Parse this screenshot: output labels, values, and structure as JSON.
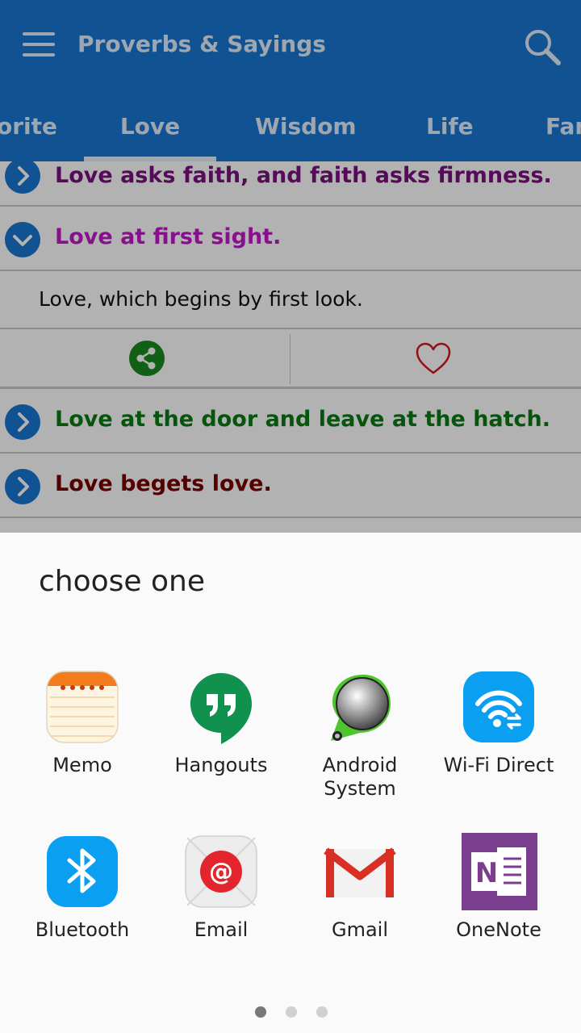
{
  "appbar": {
    "title": "Proverbs & Sayings"
  },
  "tabs": [
    {
      "label": "Favorite",
      "display": "orite"
    },
    {
      "label": "Love",
      "selected": true
    },
    {
      "label": "Wisdom"
    },
    {
      "label": "Life"
    },
    {
      "label": "Family",
      "display": "Far"
    }
  ],
  "proverbs": [
    {
      "text": "Love asks faith, and faith asks firmness.",
      "color": "#7b1080",
      "expanded": false
    },
    {
      "text": "Love at first sight.",
      "color": "#c218c9",
      "expanded": true,
      "meaning": "Love, which begins by first look."
    },
    {
      "text": "Love at the door and leave at the hatch.",
      "color": "#0a7a14",
      "expanded": false
    },
    {
      "text": "Love begets love.",
      "color": "#7a0000",
      "expanded": false
    }
  ],
  "actions": {
    "share_icon": "share-icon",
    "favorite_icon": "heart-outline-icon"
  },
  "share_sheet": {
    "title": "choose one",
    "apps": [
      {
        "label": "Memo",
        "icon": "memo-icon"
      },
      {
        "label": "Hangouts",
        "icon": "hangouts-icon"
      },
      {
        "label": "Android System",
        "line1": "Android",
        "line2": "System",
        "icon": "android-system-icon"
      },
      {
        "label": "Wi-Fi Direct",
        "icon": "wifi-direct-icon"
      },
      {
        "label": "Bluetooth",
        "icon": "bluetooth-icon"
      },
      {
        "label": "Email",
        "icon": "email-icon"
      },
      {
        "label": "Gmail",
        "icon": "gmail-icon"
      },
      {
        "label": "OneNote",
        "icon": "onenote-icon"
      }
    ],
    "pages": 3,
    "current_page": 1
  },
  "colors": {
    "primary": "#1976d2",
    "appbar_text": "#e3eefb"
  }
}
